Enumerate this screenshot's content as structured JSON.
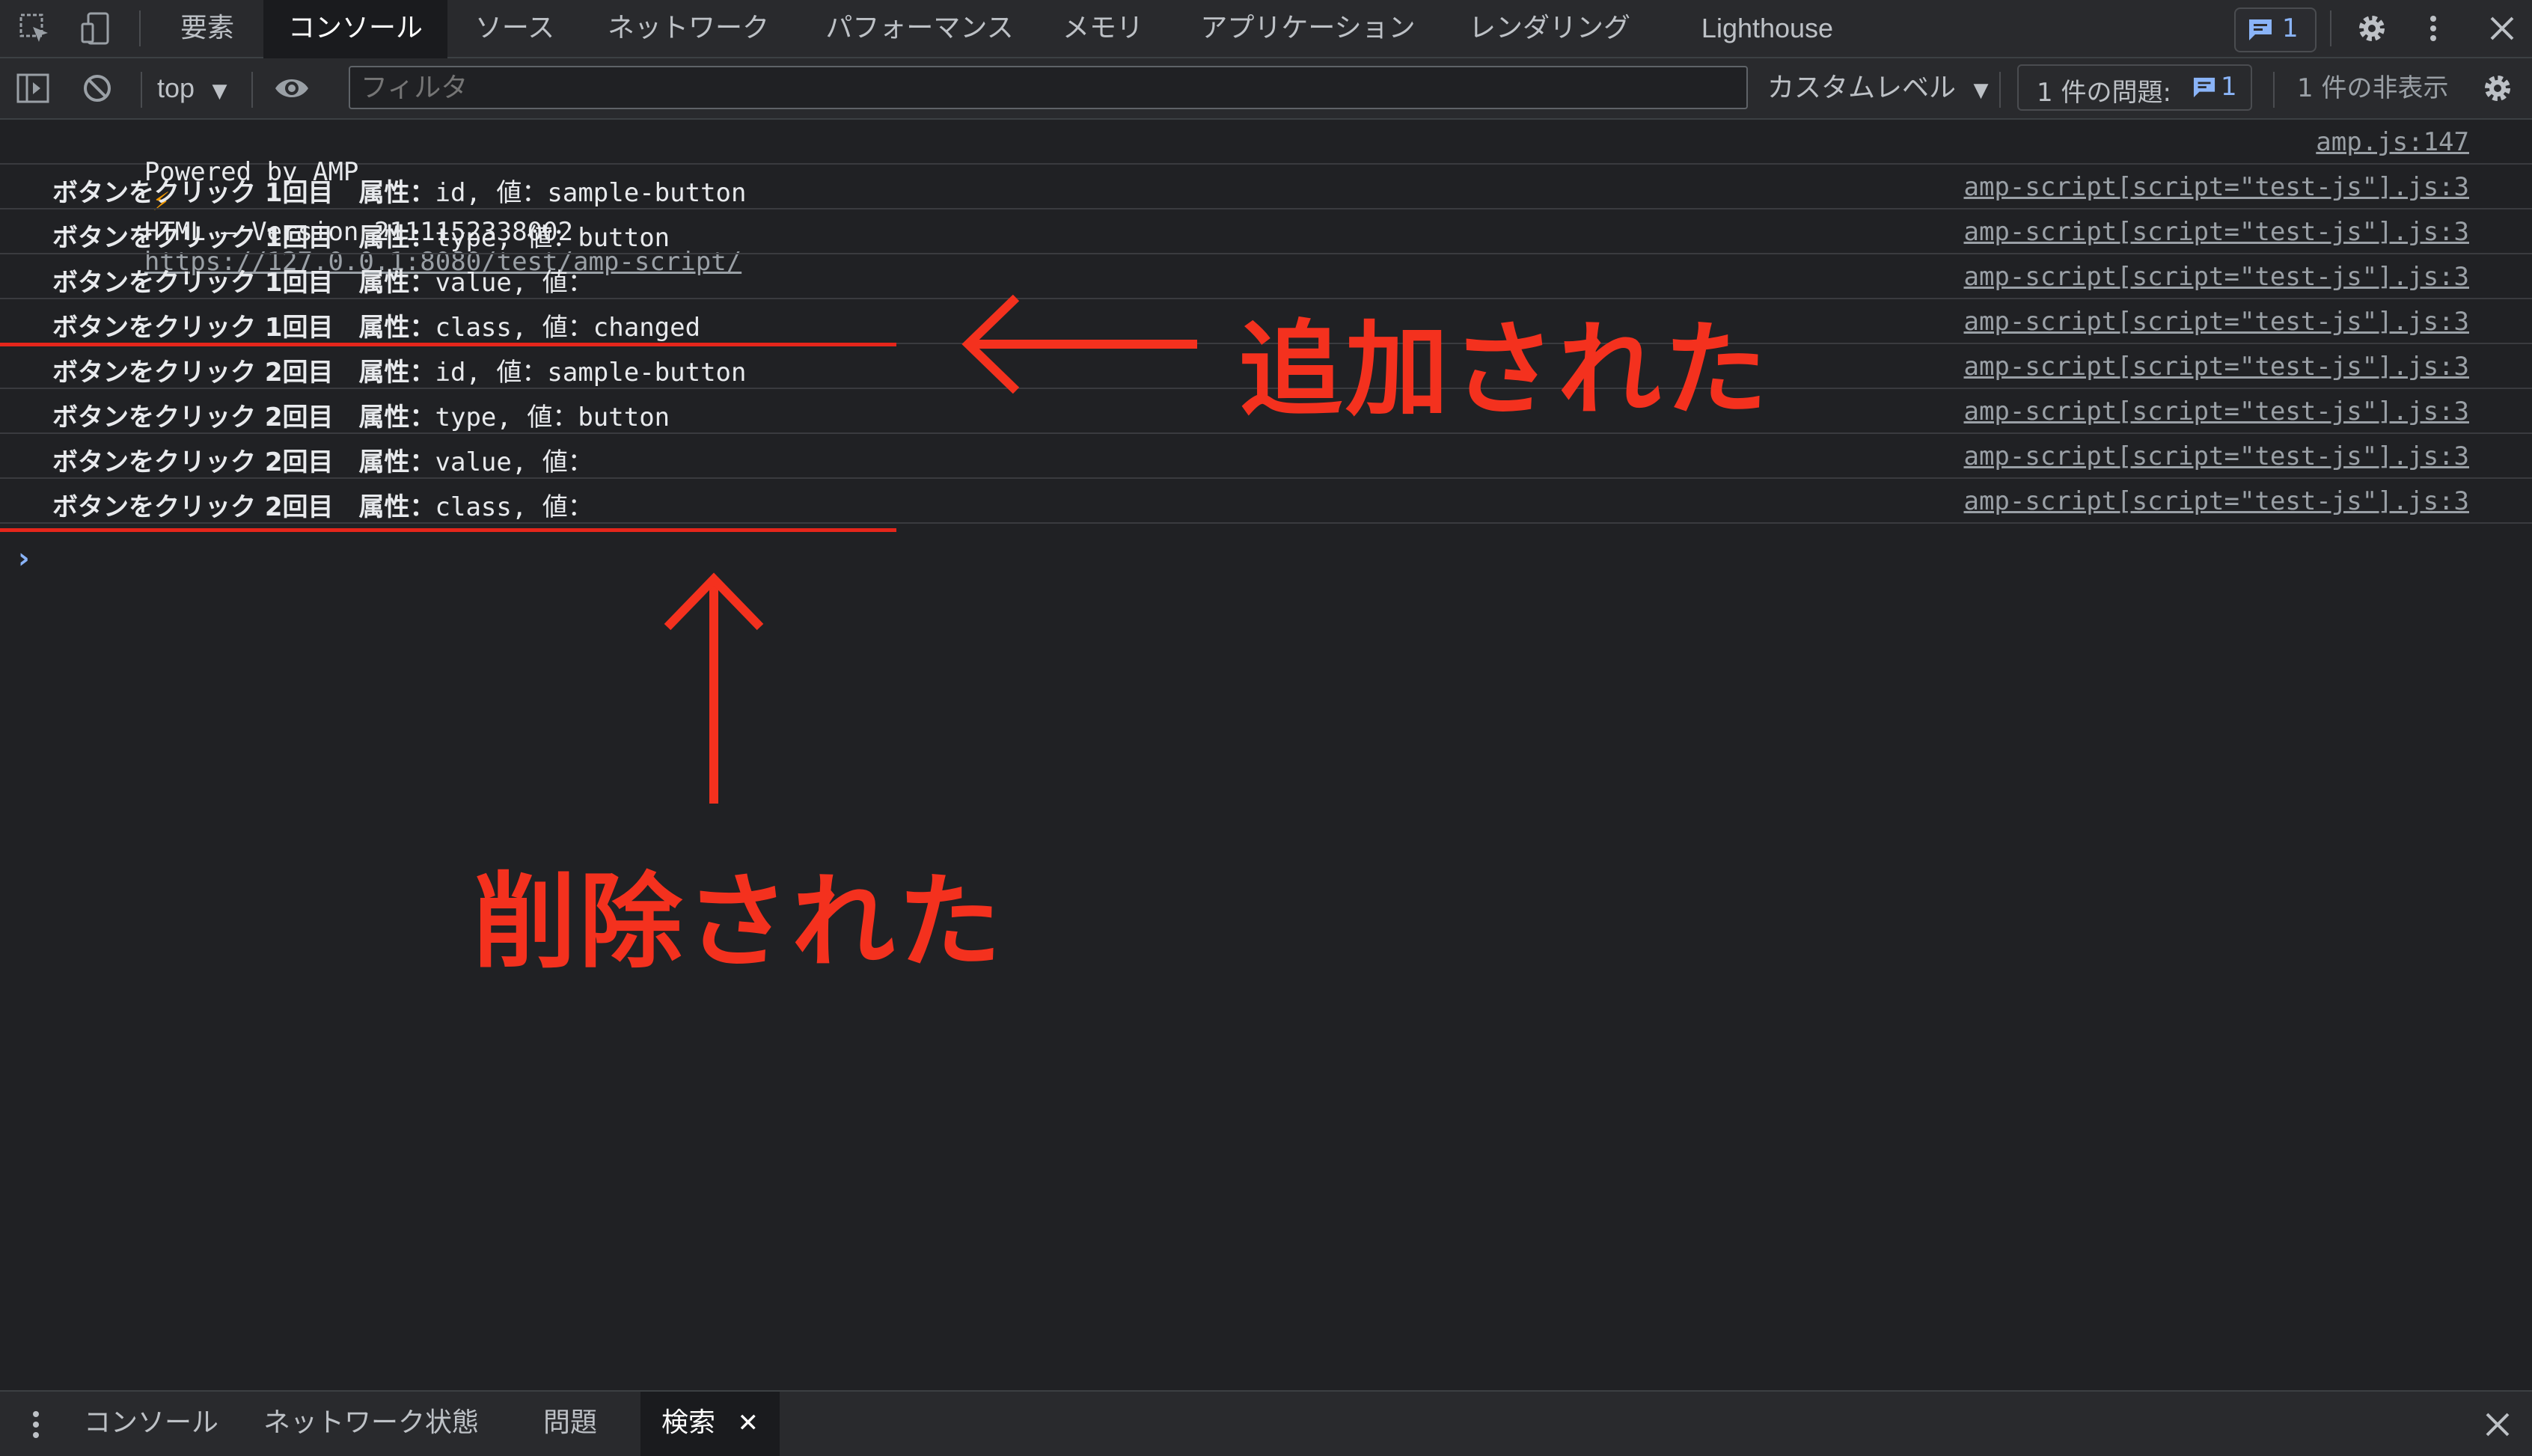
{
  "topbar": {
    "tabs": [
      {
        "label": "要素"
      },
      {
        "label": "コンソール"
      },
      {
        "label": "ソース"
      },
      {
        "label": "ネットワーク"
      },
      {
        "label": "パフォーマンス"
      },
      {
        "label": "メモリ"
      },
      {
        "label": "アプリケーション"
      },
      {
        "label": "レンダリング"
      },
      {
        "label": "Lighthouse"
      }
    ],
    "active_tab": "コンソール",
    "issues_badge_count": "1"
  },
  "toolbar": {
    "context": "top",
    "filter_placeholder": "フィルタ",
    "levels": "カスタムレベル",
    "issues_label": "1 件の問題:",
    "issues_count": "1",
    "hidden_label": "1 件の非表示"
  },
  "console": {
    "header": {
      "message": "Powered by AMP",
      "message2": "HTML – Version 2111152338002",
      "url": "https://127.0.0.1:8080/test/amp-script/",
      "source": "amp.js:147"
    },
    "rows": [
      {
        "prefix": "ボタンをクリック 1回目　属性：",
        "text": "id, 値：sample-button",
        "source": "amp-script[script=\"test-js\"].js:3"
      },
      {
        "prefix": "ボタンをクリック 1回目　属性：",
        "text": "type, 値：button",
        "source": "amp-script[script=\"test-js\"].js:3"
      },
      {
        "prefix": "ボタンをクリック 1回目　属性：",
        "text": "value, 値：",
        "source": "amp-script[script=\"test-js\"].js:3"
      },
      {
        "prefix": "ボタンをクリック 1回目　属性：",
        "text": "class, 値：changed",
        "source": "amp-script[script=\"test-js\"].js:3"
      },
      {
        "prefix": "ボタンをクリック 2回目　属性：",
        "text": "id, 値：sample-button",
        "source": "amp-script[script=\"test-js\"].js:3"
      },
      {
        "prefix": "ボタンをクリック 2回目　属性：",
        "text": "type, 値：button",
        "source": "amp-script[script=\"test-js\"].js:3"
      },
      {
        "prefix": "ボタンをクリック 2回目　属性：",
        "text": "value, 値：",
        "source": "amp-script[script=\"test-js\"].js:3"
      },
      {
        "prefix": "ボタンをクリック 2回目　属性：",
        "text": "class, 値：",
        "source": "amp-script[script=\"test-js\"].js:3"
      }
    ],
    "prompt": "›"
  },
  "annotations": {
    "added": "追加された",
    "removed": "削除された",
    "color": "#f4311e"
  },
  "drawer": {
    "tabs": [
      {
        "label": "コンソール"
      },
      {
        "label": "ネットワーク状態"
      },
      {
        "label": "問題"
      },
      {
        "label": "検索"
      }
    ],
    "active_tab": "検索"
  }
}
